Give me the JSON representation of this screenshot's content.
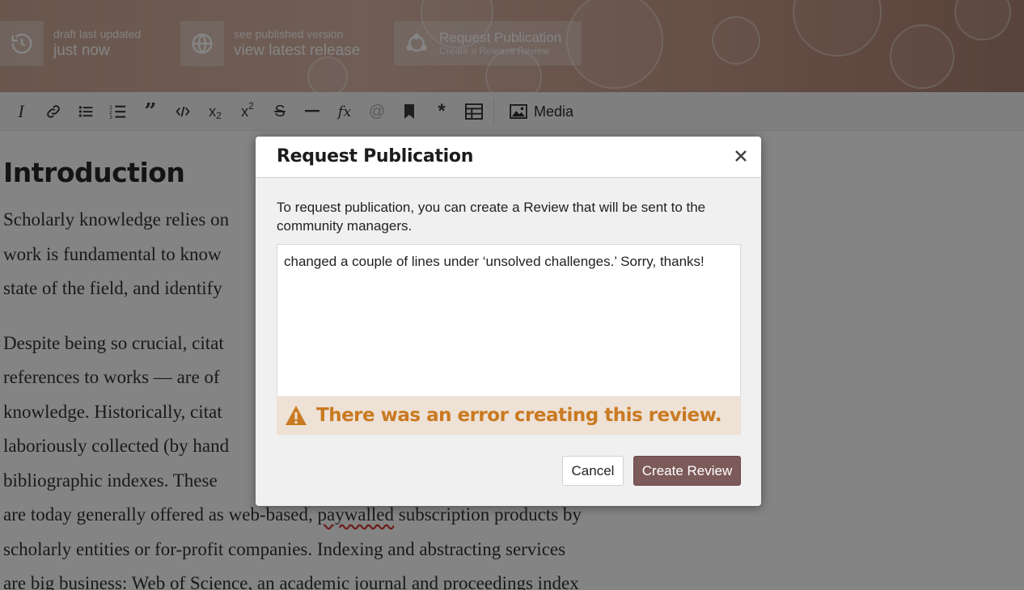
{
  "header": {
    "draft": {
      "small": "draft last updated",
      "big": "just now"
    },
    "published": {
      "small": "see published version",
      "big": "view latest release"
    },
    "request": {
      "title": "Request Publication",
      "subtitle": "Create a Release Review"
    }
  },
  "toolbar": {
    "buttons": [
      {
        "icon": "italic-icon"
      },
      {
        "icon": "link-icon"
      },
      {
        "icon": "bullet-list-icon"
      },
      {
        "icon": "numbered-list-icon"
      },
      {
        "icon": "quote-icon"
      },
      {
        "icon": "code-icon"
      },
      {
        "icon": "subscript-icon"
      },
      {
        "icon": "superscript-icon"
      },
      {
        "icon": "strikethrough-icon"
      },
      {
        "icon": "horizontal-rule-icon"
      },
      {
        "icon": "equation-icon"
      },
      {
        "icon": "mention-icon"
      },
      {
        "icon": "bookmark-icon"
      },
      {
        "icon": "footnote-icon"
      },
      {
        "icon": "table-icon"
      }
    ],
    "media_label": "Media"
  },
  "document": {
    "heading": "Introduction",
    "lines": [
      "Scholarly knowledge relies on",
      "work is fundamental to know",
      "state of the field, and identify",
      "Despite being so crucial, citat",
      "references to works — are of",
      "knowledge. Historically, citat",
      "laboriously collected (by hand",
      "bibliographic indexes. These",
      "are today generally offered as web-based, ",
      "scholarly entities or for-profit companies. Indexing and abstracting services",
      "are big business: Web of Science, an academic journal and proceedings index"
    ],
    "misspelled_word": "paywalled",
    "line_tail": " subscription products by"
  },
  "modal": {
    "title": "Request Publication",
    "description": "To request publication, you can create a Review that will be sent to the community managers.",
    "review_text": "changed a couple of lines under ‘unsolved challenges.’ Sorry, thanks!",
    "error_message": "There was an error creating this review.",
    "cancel_label": "Cancel",
    "create_label": "Create Review"
  },
  "colors": {
    "primary_button": "#7d5a5a",
    "error_text": "#c97a21",
    "error_bg": "#eee1d6"
  }
}
